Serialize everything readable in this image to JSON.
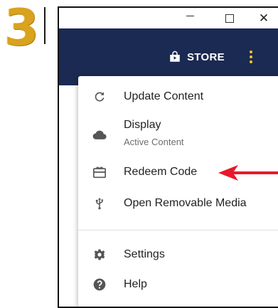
{
  "step": {
    "number": "3"
  },
  "window": {
    "controls": {
      "minimize": "",
      "maximize": "",
      "close": "✕"
    }
  },
  "header": {
    "store_label": "STORE",
    "background_color": "#1b2a52",
    "accent_color": "#f2c12e"
  },
  "menu": {
    "items": [
      {
        "label": "Update Content",
        "icon": "refresh-icon"
      },
      {
        "label": "Display",
        "sublabel": "Active Content",
        "icon": "cloud-icon"
      },
      {
        "label": "Redeem Code",
        "icon": "gift-card-icon"
      },
      {
        "label": "Open Removable Media",
        "icon": "usb-icon"
      },
      {
        "label": "Settings",
        "icon": "gear-icon"
      },
      {
        "label": "Help",
        "icon": "help-icon"
      }
    ]
  },
  "annotation": {
    "arrow_color": "#e8192c",
    "points_to": "Redeem Code"
  }
}
